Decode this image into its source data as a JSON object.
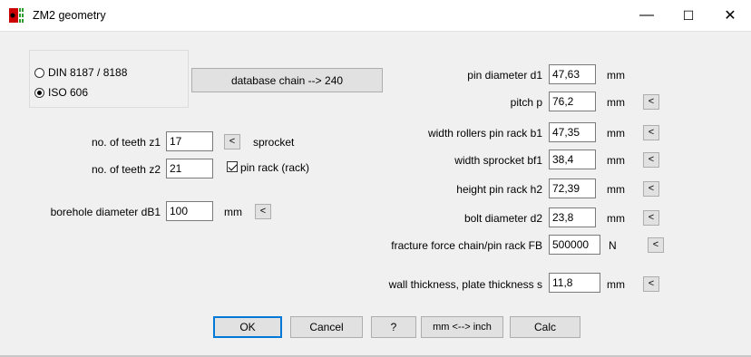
{
  "window": {
    "title": "ZM2 geometry",
    "minimize": "—",
    "maximize": "☐",
    "close": "✕"
  },
  "standard": {
    "options": [
      {
        "label": "DIN 8187 / 8188",
        "checked": false
      },
      {
        "label": "ISO 606",
        "checked": true
      }
    ]
  },
  "database_button": "database chain  -->  240",
  "left": {
    "teeth_z1": {
      "label": "no. of teeth z1",
      "value": "17",
      "unit": "sprocket",
      "btn": "<"
    },
    "teeth_z2": {
      "label": "no. of teeth z2",
      "value": "21"
    },
    "pin_rack": {
      "label": "pin rack (rack)",
      "checked": true
    },
    "borehole": {
      "label": "borehole diameter dB1",
      "value": "100",
      "unit": "mm",
      "btn": "<"
    }
  },
  "right": {
    "pin_diameter": {
      "label": "pin diameter d1",
      "value": "47,63",
      "unit": "mm"
    },
    "pitch": {
      "label": "pitch p",
      "value": "76,2",
      "unit": "mm",
      "btn": "<"
    },
    "width_rollers": {
      "label": "width rollers pin rack b1",
      "value": "47,35",
      "unit": "mm",
      "btn": "<"
    },
    "width_sprocket": {
      "label": "width sprocket bf1",
      "value": "38,4",
      "unit": "mm",
      "btn": "<"
    },
    "height_pin_rack": {
      "label": "height pin rack h2",
      "value": "72,39",
      "unit": "mm",
      "btn": "<"
    },
    "bolt_diameter": {
      "label": "bolt diameter d2",
      "value": "23,8",
      "unit": "mm",
      "btn": "<"
    },
    "fracture_force": {
      "label": "fracture force chain/pin rack FB",
      "value": "500000",
      "unit": "N",
      "btn": "<"
    },
    "wall_thickness": {
      "label": "wall thickness, plate thickness s",
      "value": "11,8",
      "unit": "mm",
      "btn": "<"
    }
  },
  "buttons": {
    "ok": "OK",
    "cancel": "Cancel",
    "help": "?",
    "units": "mm <--> inch",
    "calc": "Calc"
  },
  "colors": {
    "accent": "#0078d7",
    "icon_red": "#cc0000",
    "icon_green": "#2e9c2e"
  }
}
